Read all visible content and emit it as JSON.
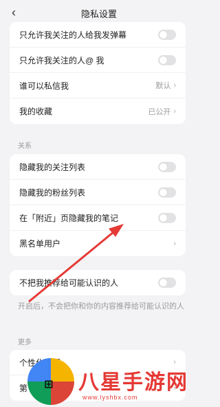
{
  "header": {
    "title": "隐私设置",
    "back_icon": "chevron-left-icon"
  },
  "privacy": {
    "rows": [
      {
        "label": "只允许我关注的人给我发弹幕"
      },
      {
        "label": "只允许我关注的人@ 我"
      },
      {
        "label": "谁可以私信我",
        "value": "默认"
      },
      {
        "label": "我的收藏",
        "value": "已公开"
      }
    ]
  },
  "relations": {
    "section": "关系",
    "rows": [
      {
        "label": "隐藏我的关注列表"
      },
      {
        "label": "隐藏我的粉丝列表"
      },
      {
        "label": "在「附近」页隐藏我的笔记"
      },
      {
        "label": "黑名单用户"
      }
    ]
  },
  "recommend": {
    "label": "不把我推荐给可能认识的人",
    "hint": "开启后，不会把你和你的内容推荐给可能认识的人"
  },
  "more": {
    "section": "更多",
    "rows": [
      {
        "label": "个性化选项"
      },
      {
        "label": "第"
      }
    ]
  },
  "watermark": {
    "text": "八星手游网",
    "url": "www.lyshbx.com"
  },
  "colors": {
    "arrow": "#e53935",
    "toggle_off": "#e2e2e4"
  }
}
